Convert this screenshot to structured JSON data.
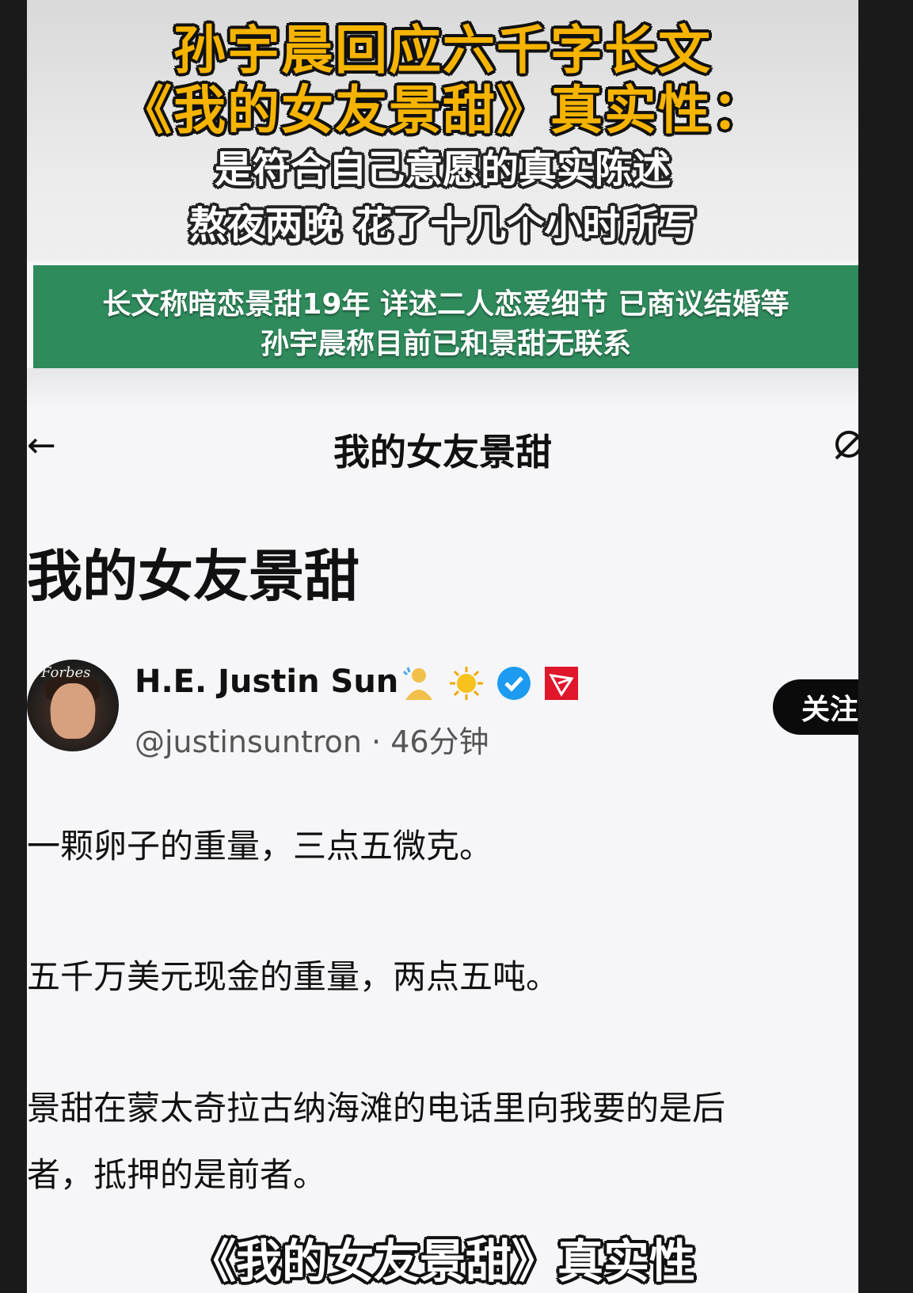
{
  "headline": {
    "line1": "孙宇晨回应六千字长文",
    "line2": "《我的女友景甜》真实性：",
    "line3": "是符合自己意愿的真实陈述",
    "line4": "熬夜两晚 花了十几个小时所写"
  },
  "summary": {
    "line1": "长文称暗恋景甜19年 详述二人恋爱细节 已商议结婚等",
    "line2": "孙宇晨称目前已和景甜无联系"
  },
  "app": {
    "back_icon": "←",
    "title": "我的女友景甜"
  },
  "post": {
    "title": "我的女友景甜",
    "author": {
      "name": "H.E. Justin Sun",
      "handle": "@justinsuntron · 46分钟",
      "avatar_text": "Forbes",
      "badges": [
        "person-icon",
        "sun-icon",
        "verified-icon",
        "tron-icon"
      ]
    },
    "follow_label": "关注",
    "paragraphs": [
      "一颗卵子的重量，三点五微克。",
      "五千万美元现金的重量，两点五吨。",
      "景甜在蒙太奇拉古纳海滩的电话里向我要的是后",
      "者，抵押的是前者。"
    ]
  },
  "video_subtitle": "《我的女友景甜》真实性",
  "colors": {
    "headline_yellow": "#f6b400",
    "summary_green": "#2f8a5c",
    "verified_blue": "#1d9bf0",
    "tron_red": "#e0162b"
  }
}
